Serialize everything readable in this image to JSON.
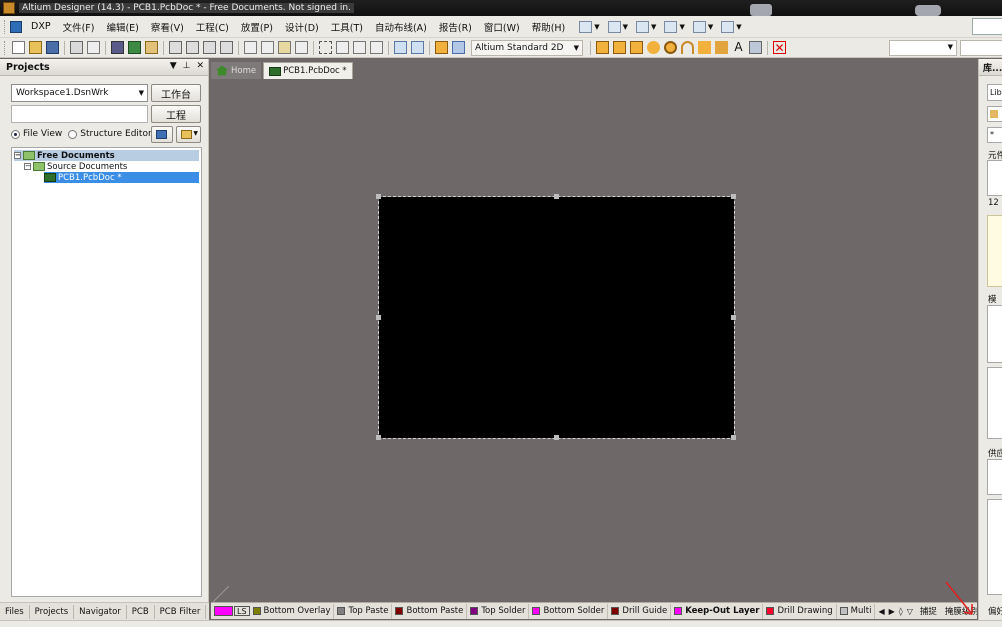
{
  "window": {
    "title": "Altium Designer (14.3) - PCB1.PcbDoc * - Free Documents. Not signed in."
  },
  "menubar": {
    "items": [
      "DXP",
      "文件(F)",
      "编辑(E)",
      "察看(V)",
      "工程(C)",
      "放置(P)",
      "设计(D)",
      "工具(T)",
      "自动布线(A)",
      "报告(R)",
      "窗口(W)",
      "帮助(H)"
    ]
  },
  "toolbar": {
    "view_mode": "Altium Standard 2D"
  },
  "projects_panel": {
    "title": "Projects",
    "workspace": "Workspace1.DsnWrk",
    "workspace_button": "工作台",
    "project_button": "工程",
    "file_view": "File View",
    "structure_editor": "Structure Editor",
    "tree": {
      "root": "Free Documents",
      "folder": "Source Documents",
      "file": "PCB1.PcbDoc *"
    },
    "tabs": [
      "Files",
      "Projects",
      "Navigator",
      "PCB",
      "PCB Filter"
    ]
  },
  "doc_tabs": {
    "home": "Home",
    "pcb": "PCB1.PcbDoc *"
  },
  "layer_bar": {
    "current": "LS",
    "layers": [
      {
        "name": "Bottom Overlay",
        "color": "#808000"
      },
      {
        "name": "Top Paste",
        "color": "#808080"
      },
      {
        "name": "Bottom Paste",
        "color": "#800000"
      },
      {
        "name": "Top Solder",
        "color": "#800080"
      },
      {
        "name": "Bottom Solder",
        "color": "#ff00ff"
      },
      {
        "name": "Drill Guide",
        "color": "#800000"
      },
      {
        "name": "Keep-Out Layer",
        "color": "#ff00ff"
      },
      {
        "name": "Drill Drawing",
        "color": "#ff002a"
      },
      {
        "name": "Multi",
        "color": "#c0c0c0"
      }
    ],
    "snap": "捕捉",
    "mask_level": "掩膜级别",
    "clear": "清除"
  },
  "library_panel": {
    "title": "库...",
    "lib_button": "Lib",
    "search_value": "*",
    "component_label": "元件",
    "count_text": "12 c",
    "model_label": "模",
    "supplier_label": "供应",
    "pref_label": "偏好"
  },
  "colors": {
    "canvas": "#6e6868",
    "board": "#000000",
    "selection": "#3a8ee6"
  }
}
